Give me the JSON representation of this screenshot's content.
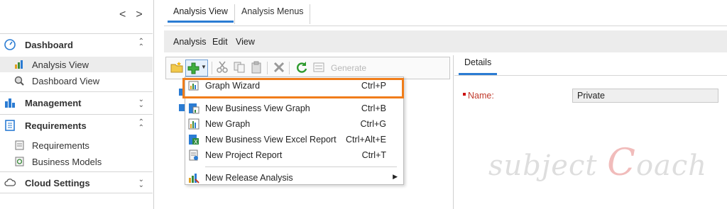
{
  "sidebar": {
    "nav_back": "<",
    "nav_forward": ">",
    "sections": [
      {
        "label": "Dashboard",
        "expanded": true,
        "items": [
          "Analysis View",
          "Dashboard View"
        ]
      },
      {
        "label": "Management",
        "expanded": false
      },
      {
        "label": "Requirements",
        "expanded": true,
        "items": [
          "Requirements",
          "Business Models"
        ]
      },
      {
        "label": "Cloud Settings",
        "expanded": false
      }
    ],
    "selected_item": "Analysis View"
  },
  "tabs": [
    "Analysis View",
    "Analysis Menus"
  ],
  "active_tab": "Analysis View",
  "menubar": [
    "Analysis",
    "Edit",
    "View"
  ],
  "toolbar": {
    "generate_label": "Generate"
  },
  "details": {
    "tab_label": "Details",
    "name_label": "Name:",
    "name_value": "Private"
  },
  "context_menu": {
    "items": [
      {
        "label": "Graph Wizard",
        "shortcut": "Ctrl+P"
      },
      {
        "label": "New Business View Graph",
        "shortcut": "Ctrl+B"
      },
      {
        "label": "New Graph",
        "shortcut": "Ctrl+G"
      },
      {
        "label": "New Business View Excel Report",
        "shortcut": "Ctrl+Alt+E"
      },
      {
        "label": "New Project Report",
        "shortcut": "Ctrl+T"
      },
      {
        "label": "New Release Analysis",
        "shortcut": ""
      }
    ],
    "highlighted": "Graph Wizard"
  },
  "watermark": {
    "text_a": "subject",
    "text_c": "C",
    "text_b": "oach"
  },
  "colors": {
    "accent": "#2b7cd3",
    "highlight": "#f07d1a",
    "required": "#cc1111"
  }
}
